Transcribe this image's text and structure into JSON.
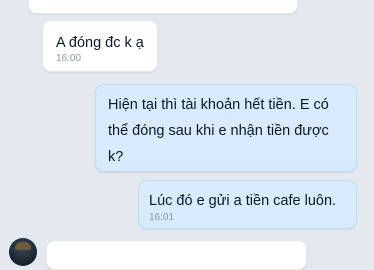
{
  "messages": [
    {
      "text": "",
      "time": ""
    },
    {
      "text": "A đóng đc k ạ",
      "time": "16:00"
    },
    {
      "text": "Hiện tại thì tài khoản hết tiền. E có\nthể đóng sau khi e nhận tiền được\nk?",
      "time": ""
    },
    {
      "text": "Lúc đó e gửi a tiền cafe luôn.",
      "time": "16:01"
    },
    {
      "text": "",
      "time": ""
    }
  ]
}
